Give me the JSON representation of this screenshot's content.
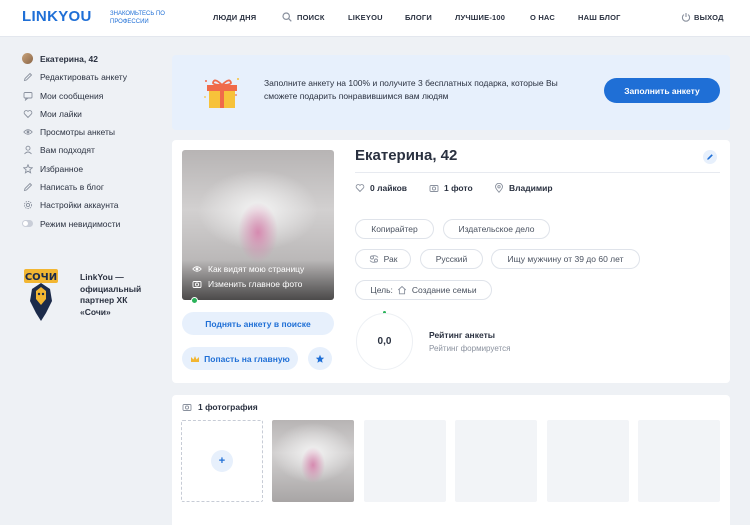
{
  "header": {
    "logo": "LINKYOU",
    "tagline": "ЗНАКОМЬТЕСЬ ПО ПРОФЕССИИ",
    "nav": [
      "ЛЮДИ ДНЯ",
      "ПОИСК",
      "LIKEYOU",
      "БЛОГИ",
      "ЛУЧШИЕ-100",
      "О НАС",
      "НАШ БЛОГ"
    ],
    "logout": "ВЫХОД"
  },
  "sidebar": {
    "profile": "Екатерина, 42",
    "items": [
      "Редактировать анкету",
      "Мои сообщения",
      "Мои лайки",
      "Просмотры анкеты",
      "Вам подходят",
      "Избранное",
      "Написать в блог",
      "Настройки аккаунта",
      "Режим невидимости"
    ],
    "partner_text": "LinkYou — официальный партнер ХК «Сочи»"
  },
  "banner": {
    "text": "Заполните анкету на 100% и получите 3 бесплатных подарка, которые Вы сможете подарить понравившимся вам людям",
    "button": "Заполнить анкету"
  },
  "profile": {
    "name": "Екатерина, 42",
    "photo_links": [
      "Как видят мою страницу",
      "Изменить главное фото"
    ],
    "raise_button": "Поднять анкету в поиске",
    "home_button": "Попасть на главную",
    "likes": "0 лайков",
    "photos": "1 фото",
    "city": "Владимир",
    "chips": [
      "Копирайтер",
      "Издательское дело",
      "Рак",
      "Русский",
      "Ищу мужчину от 39 до 60 лет"
    ],
    "goal_label": "Цель:",
    "goal_value": "Создание семьи",
    "rating_value": "0,0",
    "rating_title": "Рейтинг анкеты",
    "rating_sub": "Рейтинг формируется"
  },
  "photos_section": {
    "title": "1 фотография",
    "add": "+"
  },
  "colors": {
    "accent": "#1f6fd6",
    "online": "#2bb35a"
  }
}
